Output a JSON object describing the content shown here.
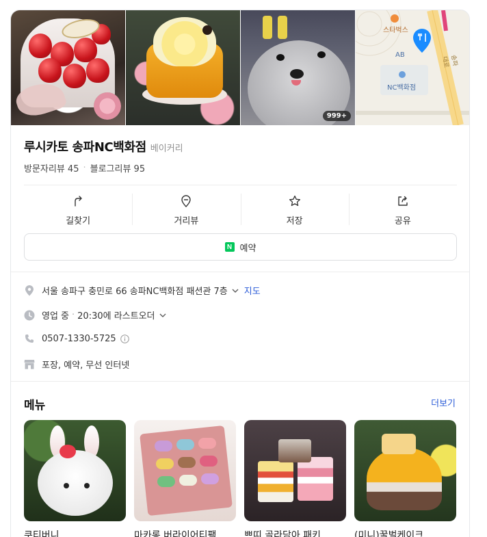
{
  "place": {
    "name": "루시카토 송파NC백화점",
    "category": "베이커리",
    "visitor_reviews": "방문자리뷰 45",
    "blog_reviews": "블로그리뷰 95",
    "photo_count": "999+"
  },
  "map": {
    "label_starbucks": "스타벅스",
    "label_ab": "AB",
    "label_store": "NC백화점",
    "label_road": "송파대로"
  },
  "actions": [
    {
      "label": "길찾기",
      "icon": "directions-icon"
    },
    {
      "label": "거리뷰",
      "icon": "streetview-icon"
    },
    {
      "label": "저장",
      "icon": "star-icon"
    },
    {
      "label": "공유",
      "icon": "share-icon"
    }
  ],
  "reserve": {
    "label": "예약",
    "badge": "N"
  },
  "info": {
    "address": "서울 송파구 충민로 66 송파NC백화점 패션관 7층",
    "map_link": "지도",
    "status": "영업 중",
    "hours": "20:30에 라스트오더",
    "phone": "0507-1330-5725",
    "amenities": "포장, 예약, 무선 인터넷"
  },
  "menu": {
    "title": "메뉴",
    "more": "더보기",
    "items": [
      {
        "name": "쿠티버니"
      },
      {
        "name": "마카롱 버라이어티팩"
      },
      {
        "name": "쁘띠 골라담아 패키"
      },
      {
        "name": "(미니)꿀벌케이크"
      }
    ]
  },
  "colors": {
    "link": "#2a5bd7",
    "naver_green": "#03c75a",
    "map_pin": "#1a8cff"
  }
}
